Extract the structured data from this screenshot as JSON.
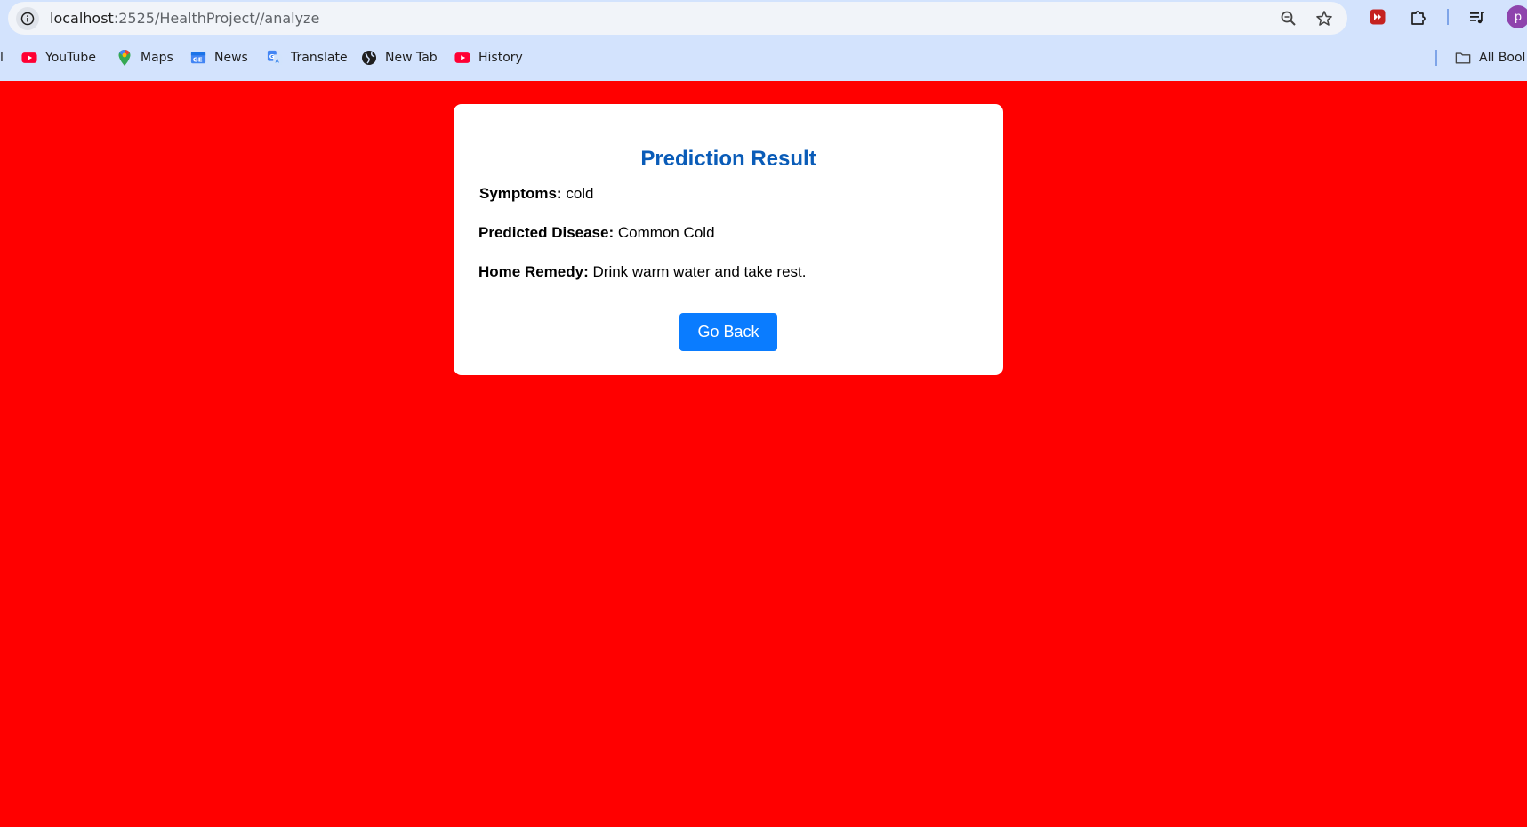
{
  "browser": {
    "url_host": "localhost",
    "url_path": ":2525/HealthProject//analyze",
    "profile_initial": "p",
    "bookmarks": [
      {
        "label": "YouTube",
        "icon": "youtube-icon"
      },
      {
        "label": "Maps",
        "icon": "maps-icon"
      },
      {
        "label": "News",
        "icon": "news-icon"
      },
      {
        "label": "Translate",
        "icon": "translate-icon"
      },
      {
        "label": "New Tab",
        "icon": "globe-icon"
      },
      {
        "label": "History",
        "icon": "youtube-icon"
      }
    ],
    "all_bookmarks_label": "All Bool",
    "first_bookmark_fragment": "l"
  },
  "colors": {
    "page_background": "#ff0000",
    "title": "#0a5cb8",
    "button": "#0a7cff",
    "browser_chrome": "#d3e3fd"
  },
  "result": {
    "title": "Prediction Result",
    "symptoms_label": "Symptoms:",
    "symptoms_value": "cold",
    "disease_label": "Predicted Disease:",
    "disease_value": "Common Cold",
    "remedy_label": "Home Remedy:",
    "remedy_value": "Drink warm water and take rest.",
    "back_button": "Go Back"
  }
}
